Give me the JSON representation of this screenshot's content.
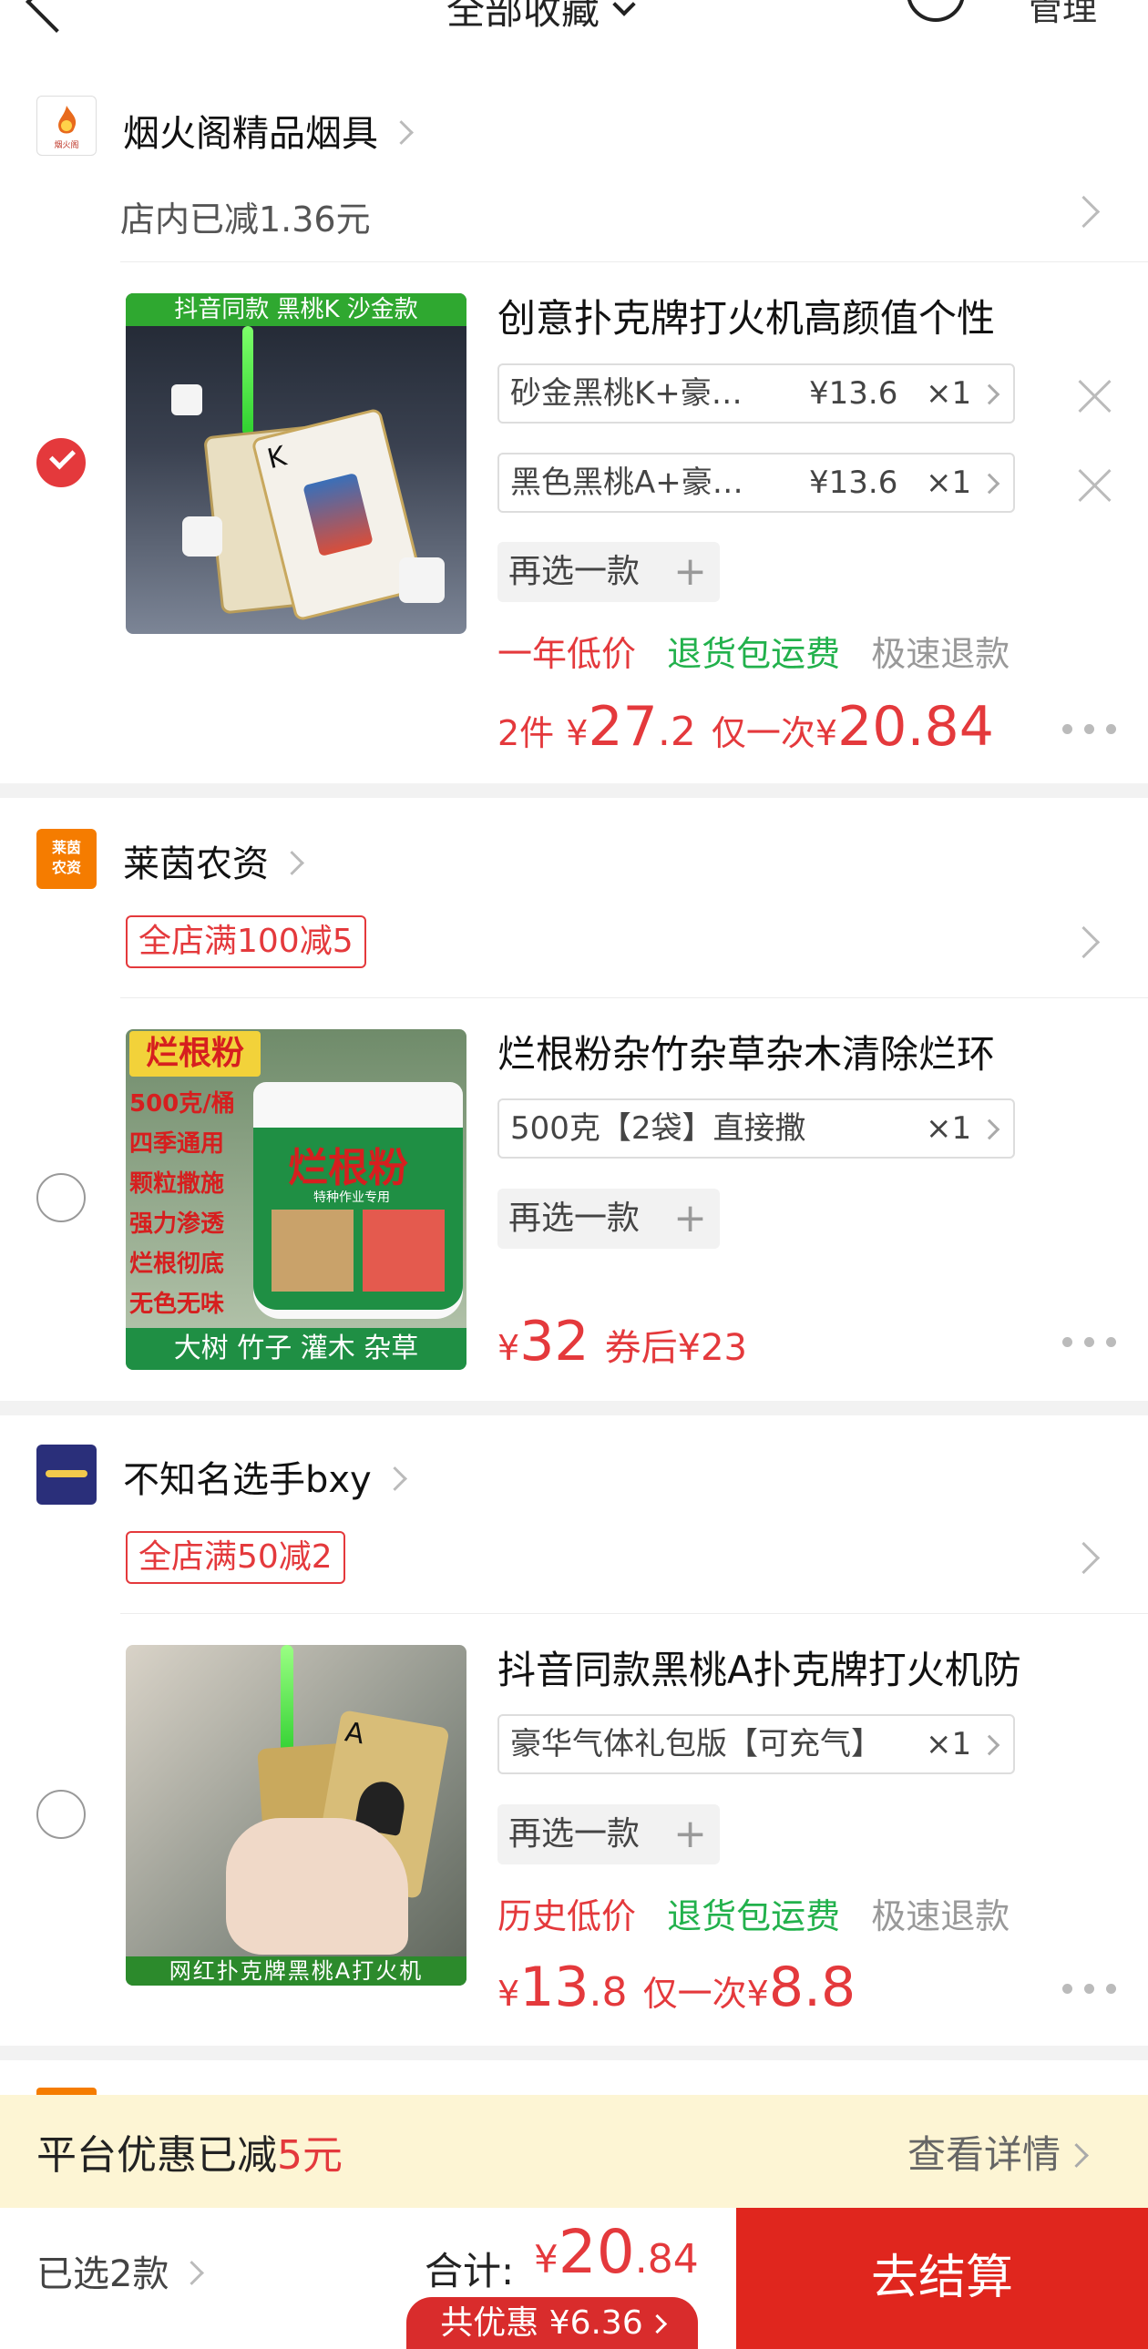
{
  "header": {
    "title": "全部收藏",
    "manage": "管理"
  },
  "stores": [
    {
      "name": "烟火阁精品烟具",
      "logo_text": "烟火阁",
      "promo": "店内已减1.36元",
      "product": {
        "title": "创意扑克牌打火机高颜值个性",
        "image_banner": "抖音同款  黑桃K  沙金款",
        "checked": true,
        "skus": [
          {
            "name": "砂金黑桃K+豪华礼包版",
            "price": "¥13.6",
            "qty": "×1"
          },
          {
            "name": "黑色黑桃A+豪华礼包版",
            "price": "¥13.6",
            "qty": "×1"
          }
        ],
        "reselect": "再选一款",
        "tags": [
          "一年低价",
          "退货包运费",
          "极速退款"
        ],
        "count": "2件",
        "price_int": "27",
        "price_dec": ".2",
        "once_label": "仅一次¥",
        "once_price": "20.84"
      }
    },
    {
      "name": "莱茵农资",
      "logo_text": "莱茵农资",
      "promo": "全店满100减5",
      "product": {
        "title": "烂根粉杂竹杂草杂木清除烂环",
        "image_title": "烂根粉",
        "image_lines": [
          "500克/桶",
          "四季通用",
          "颗粒撒施",
          "强力渗透",
          "烂根彻底",
          "无色无味"
        ],
        "image_bottom": "大树  竹子  灌木  杂草",
        "image_bucket_label": "烂根粉",
        "image_bucket_sub": "特种作业专用",
        "checked": false,
        "skus": [
          {
            "name": "500克【2袋】直接撒",
            "price": "",
            "qty": "×1"
          }
        ],
        "reselect": "再选一款",
        "price_int": "32",
        "coupon": "券后¥23"
      }
    },
    {
      "name": "不知名选手bxy",
      "promo": "全店满50减2",
      "product": {
        "title": "抖音同款黑桃A扑克牌打火机防",
        "image_banner": "网红扑克牌黑桃A打火机",
        "checked": false,
        "skus": [
          {
            "name": "豪华气体礼包版【可充气】",
            "price": "",
            "qty": "×1"
          }
        ],
        "reselect": "再选一款",
        "tags": [
          "历史低价",
          "退货包运费",
          "极速退款"
        ],
        "price_int": "13",
        "price_dec": ".8",
        "once_label": "仅一次¥",
        "once_price": "8.8"
      }
    }
  ],
  "platform": {
    "label": "平台优惠已减",
    "amount": "5元",
    "detail": "查看详情"
  },
  "checkout": {
    "selected": "已选2款",
    "total_label": "合计:",
    "total_int": "20",
    "total_dec": ".84",
    "discount": "共优惠 ¥6.36",
    "button": "去结算"
  },
  "colors": {
    "accent": "#e4393c",
    "green": "#22b14c",
    "checkout": "#e0261e",
    "platform_bg": "#fdf5d4"
  }
}
